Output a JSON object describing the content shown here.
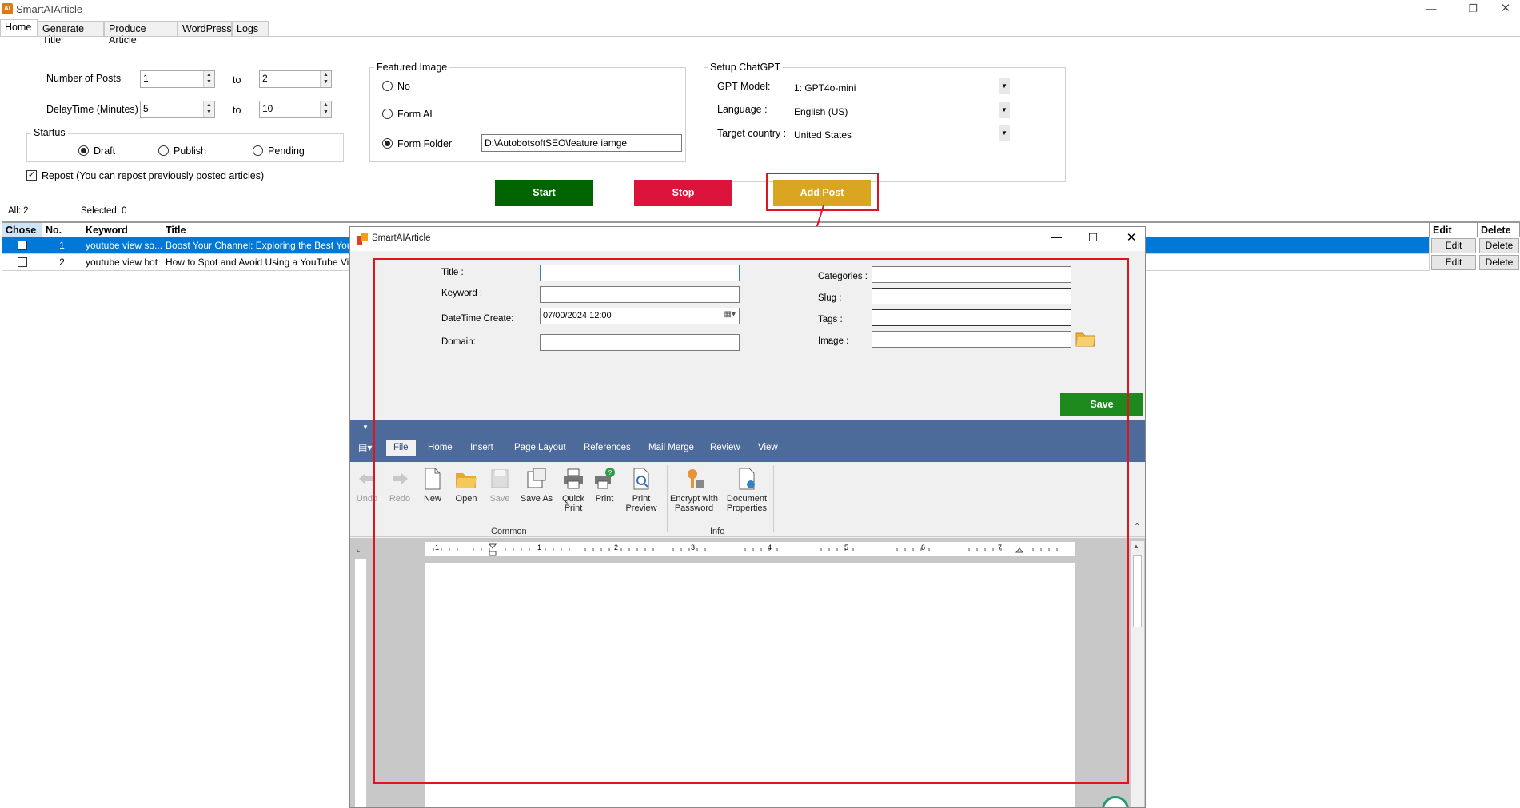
{
  "window": {
    "title": "SmartAIArticle",
    "app_icon_text": "AI"
  },
  "tabs": [
    "Home",
    "Generate Title",
    "Produce Article",
    "WordPress",
    "Logs"
  ],
  "settings": {
    "number_of_posts_label": "Number of Posts",
    "number_of_posts_from": "1",
    "number_of_posts_to": "2",
    "delay_label": "DelayTime (Minutes)",
    "delay_from": "5",
    "delay_to": "10",
    "to_label": "to",
    "status_legend": "Startus",
    "status_options": [
      "Draft",
      "Publish",
      "Pending"
    ],
    "status_selected": "Draft",
    "repost_label": "Repost (You can repost previously posted articles)",
    "repost_checked": true
  },
  "featured_image": {
    "legend": "Featured Image",
    "options": [
      "No",
      "Form AI",
      "Form Folder"
    ],
    "selected": "Form Folder",
    "folder_path": "D:\\AutobotsoftSEO\\feature iamge"
  },
  "chatgpt": {
    "legend": "Setup ChatGPT",
    "gpt_model_label": "GPT Model:",
    "gpt_model_value": "1: GPT4o-mini",
    "language_label": "Language :",
    "language_value": "English (US)",
    "country_label": "Target country :",
    "country_value": "United States"
  },
  "actions": {
    "start": "Start",
    "stop": "Stop",
    "add_post": "Add Post",
    "colors": {
      "start": "#006400",
      "stop": "#dc143c",
      "add_post": "#daa520"
    }
  },
  "counts": {
    "all": "All: 2",
    "selected": "Selected: 0"
  },
  "grid": {
    "headers": {
      "chose": "Chose",
      "no": "No.",
      "keyword": "Keyword",
      "title": "Title",
      "edit": "Edit",
      "delete": "Delete"
    },
    "rows": [
      {
        "no": "1",
        "keyword": "youtube view so...",
        "title": "Boost Your Channel: Exploring the Best YouTube",
        "edit": "Edit",
        "delete": "Delete",
        "selected": true
      },
      {
        "no": "2",
        "keyword": "youtube view bot",
        "title": "How to Spot and Avoid Using a YouTube View Bo",
        "edit": "Edit",
        "delete": "Delete",
        "selected": false
      }
    ]
  },
  "dialog": {
    "title": "SmartAIArticle",
    "fields": {
      "title_label": "Title :",
      "title_value": "",
      "keyword_label": "Keyword :",
      "keyword_value": "",
      "datetime_label": "DateTime Create:",
      "datetime_value": "07/00/2024 12:00",
      "domain_label": "Domain:",
      "domain_value": "",
      "categories_label": "Categories :",
      "slug_label": "Slug :",
      "tags_label": "Tags :",
      "image_label": "Image :"
    },
    "save": "Save",
    "ribbon_tabs": [
      "File",
      "Home",
      "Insert",
      "Page Layout",
      "References",
      "Mail Merge",
      "Review",
      "View"
    ],
    "ribbon_active": "File",
    "ribbon_buttons": {
      "undo": "Undo",
      "redo": "Redo",
      "new": "New",
      "open": "Open",
      "save": "Save",
      "save_as": "Save As",
      "quick_print_1": "Quick",
      "quick_print_2": "Print",
      "print": "Print",
      "print_preview_1": "Print",
      "print_preview_2": "Preview",
      "encrypt_1": "Encrypt with",
      "encrypt_2": "Password",
      "doc_props_1": "Document",
      "doc_props_2": "Properties"
    },
    "groups": {
      "common": "Common",
      "info": "Info"
    },
    "ruler_numbers": [
      "1",
      "1",
      "2",
      "3",
      "4",
      "5",
      "6",
      "7"
    ]
  }
}
